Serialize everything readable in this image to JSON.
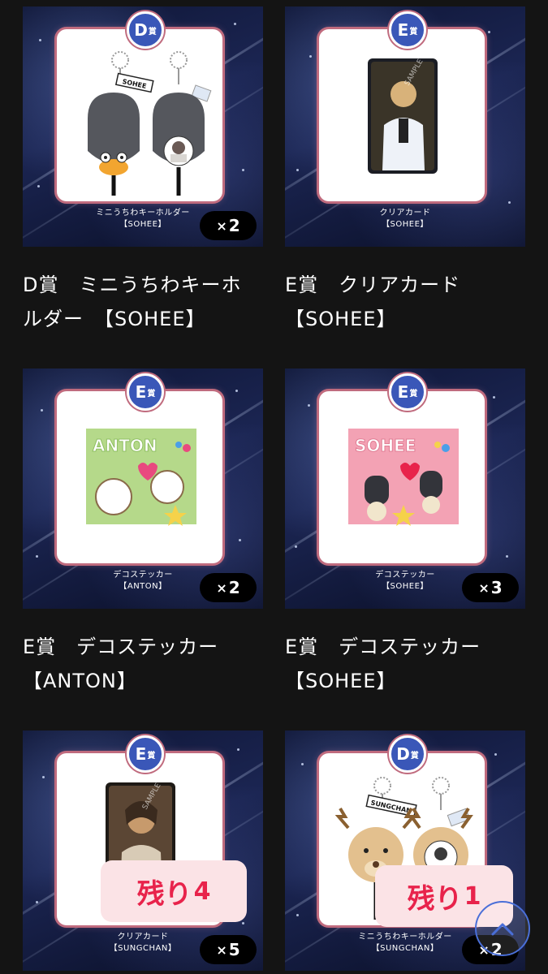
{
  "prizes": [
    {
      "grade": "D",
      "grade_suffix": "賞",
      "caption_line1": "ミニうちわキーホルダー",
      "caption_line2": "【SOHEE】",
      "qty_x": "×",
      "qty": "2",
      "title_line1": "D賞　ミニうちわキーホ",
      "title_line2": "ルダー　【SOHEE】",
      "image_tag": "SOHEE",
      "illustration": "keychain"
    },
    {
      "grade": "E",
      "grade_suffix": "賞",
      "caption_line1": "クリアカード",
      "caption_line2": "【SOHEE】",
      "qty_x": "",
      "qty": "",
      "title_line1": "E賞　クリアカード",
      "title_line2": "【SOHEE】",
      "image_tag": "SAMPLE",
      "illustration": "photocard"
    },
    {
      "grade": "E",
      "grade_suffix": "賞",
      "caption_line1": "デコステッカー",
      "caption_line2": "【ANTON】",
      "qty_x": "×",
      "qty": "2",
      "title_line1": "E賞　デコステッカー",
      "title_line2": "【ANTON】",
      "image_tag": "ANTON",
      "illustration": "sticker-green"
    },
    {
      "grade": "E",
      "grade_suffix": "賞",
      "caption_line1": "デコステッカー",
      "caption_line2": "【SOHEE】",
      "qty_x": "×",
      "qty": "3",
      "title_line1": "E賞　デコステッカー",
      "title_line2": "【SOHEE】",
      "image_tag": "SOHEE",
      "illustration": "sticker-pink"
    },
    {
      "grade": "E",
      "grade_suffix": "賞",
      "caption_line1": "クリアカード",
      "caption_line2": "【SUNGCHAN】",
      "qty_x": "×",
      "qty": "5",
      "title_line1": "",
      "title_line2": "",
      "image_tag": "SAMPLE",
      "illustration": "photocard",
      "remaining_label": "残り",
      "remaining_count": "4"
    },
    {
      "grade": "D",
      "grade_suffix": "賞",
      "caption_line1": "ミニうちわキーホルダー",
      "caption_line2": "【SUNGCHAN】",
      "qty_x": "×",
      "qty": "2",
      "title_line1": "",
      "title_line2": "",
      "image_tag": "SUNGCHAN",
      "illustration": "keychain-deer",
      "remaining_label": "残り",
      "remaining_count": "1"
    }
  ],
  "colors": {
    "page_bg": "#141414",
    "grade_badge": "#3a57b8",
    "frame_glow": "#c06b7e",
    "remaining_text": "#e8234b",
    "remaining_bg": "#fbe3e6"
  },
  "icons": {
    "scroll_top": "chevron-up-icon"
  }
}
